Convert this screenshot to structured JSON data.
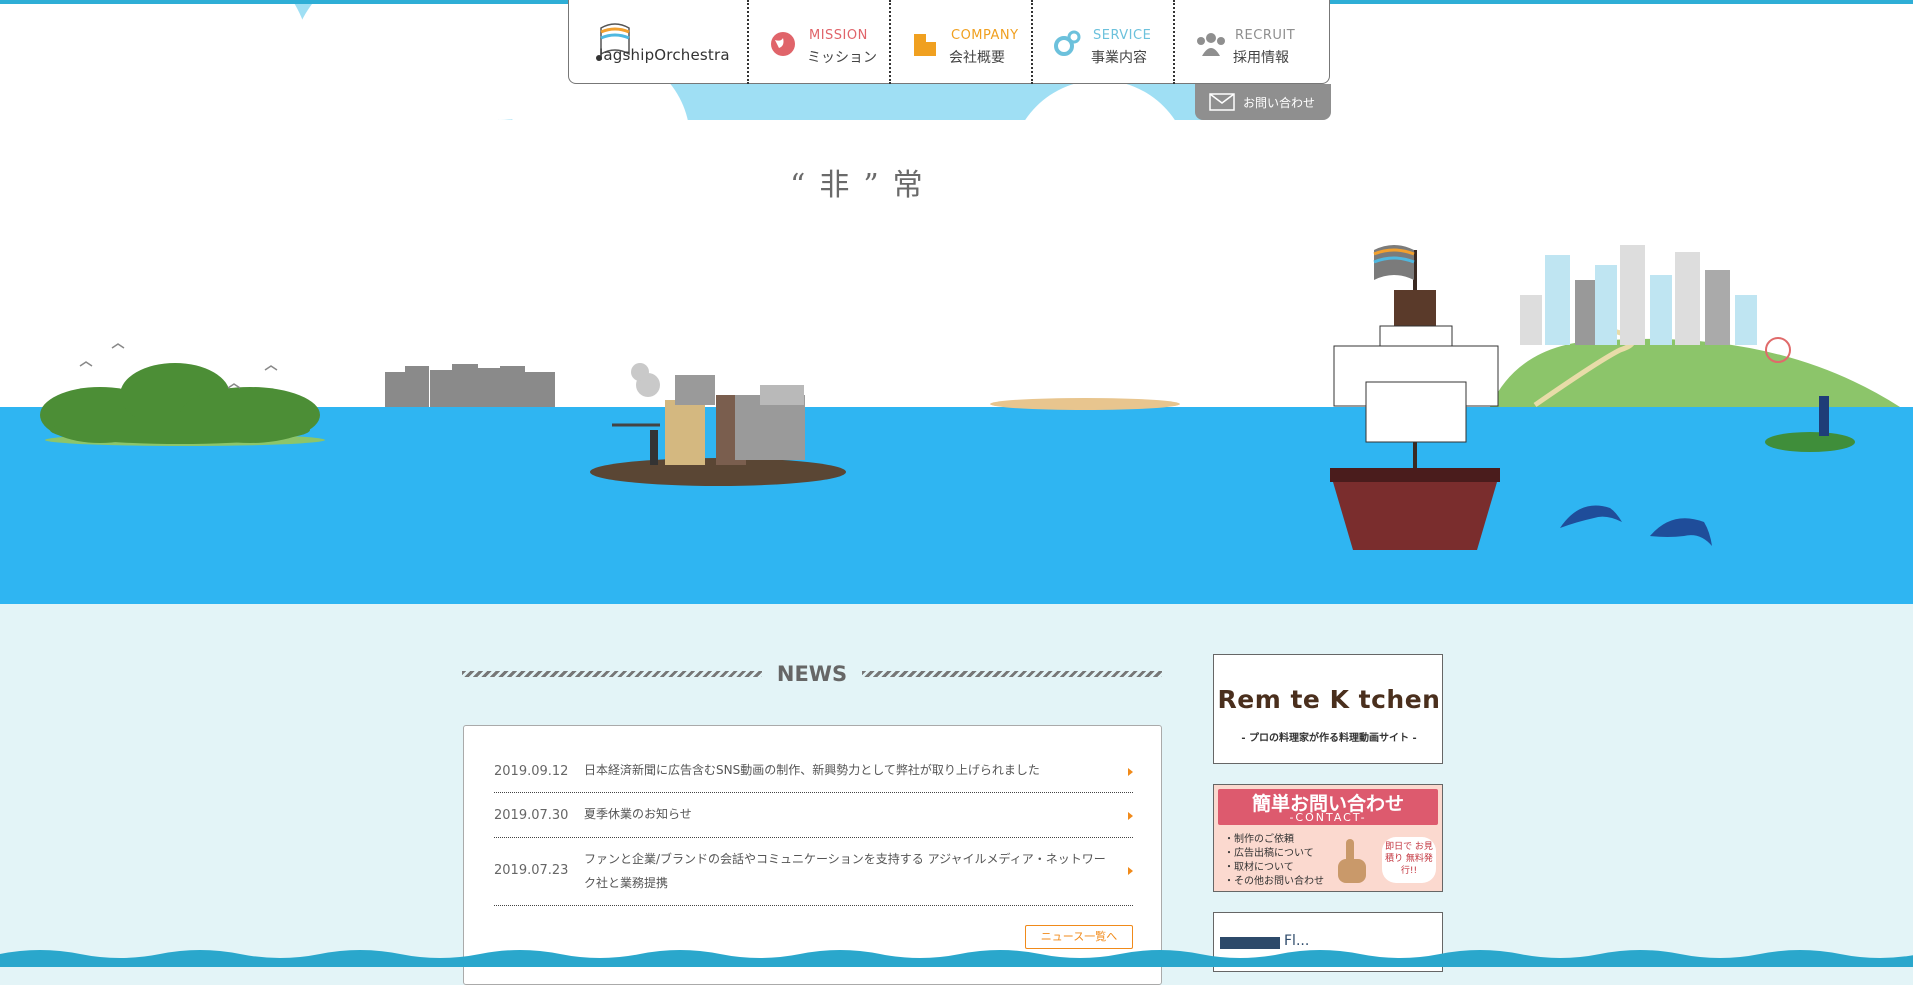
{
  "brand": {
    "logo_text": "lagshipOrchestra"
  },
  "nav": {
    "items": [
      {
        "en": "MISSION",
        "jp": "ミッション",
        "icon": "globe-icon",
        "color": "#e0646a"
      },
      {
        "en": "COMPANY",
        "jp": "会社概要",
        "icon": "building-icon",
        "color": "#f0a020"
      },
      {
        "en": "SERVICE",
        "jp": "事業内容",
        "icon": "gears-icon",
        "color": "#6cc1dc"
      },
      {
        "en": "RECRUIT",
        "jp": "採用情報",
        "icon": "people-icon",
        "color": "#8f8f8f"
      }
    ],
    "contact_label": "お問い合わせ"
  },
  "hero": {
    "catch": "“非”常"
  },
  "news": {
    "title": "NEWS",
    "items": [
      {
        "date": "2019.09.12",
        "text": "日本経済新聞に広告含むSNS動画の制作、新興勢力として弊社が取り上げられました"
      },
      {
        "date": "2019.07.30",
        "text": "夏季休業のお知らせ"
      },
      {
        "date": "2019.07.23",
        "text": "ファンと企業/ブランドの会話やコミュニケーションを支持する アジャイルメディア・ネットワーク社と業務提携"
      }
    ],
    "more_label": "ニュース一覧へ"
  },
  "banners": {
    "remote_kitchen": {
      "title": "Rem te K tchen",
      "sub": "- プロの料理家が作る料理動画サイト -"
    },
    "contact": {
      "title": "簡単お問い合わせ",
      "sub": "-CONTACT-",
      "list": [
        "・制作のご依頼",
        "・広告出稿について",
        "・取材について",
        "・その他お問い合わせ"
      ],
      "bubble": "即日で お見積り 無料発行!!"
    },
    "third": {
      "text": "Fl..."
    }
  },
  "colors": {
    "sky": "#9fdff4",
    "sea": "#2fb5f2",
    "page_bg": "#e3f4f7",
    "accent": "#f08a1a"
  }
}
